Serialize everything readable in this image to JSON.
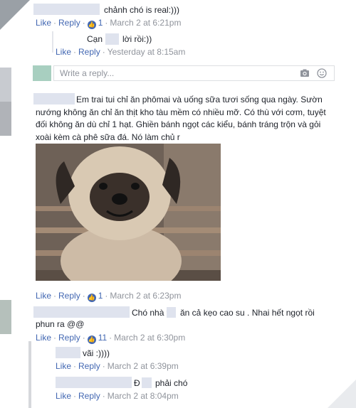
{
  "actions": {
    "like": "Like",
    "reply": "Reply",
    "separator": "·"
  },
  "comments": [
    {
      "text": "chảnh chó is real:)))",
      "likes": "1",
      "time": "March 2 at 6:21pm"
    },
    {
      "text_a": "Cạn",
      "text_b": "lời rồi:))",
      "time": "Yesterday at 8:15am"
    },
    {
      "text": "Em trai tui chỉ ăn phômai và uống sữa tươi sống qua ngày. Sườn nướng không ăn chỉ ăn thịt kho tàu mềm có nhiều mỡ. Có thù với cơm, tuyệt đối không ăn dù chỉ 1 hạt. Ghiền bánh ngọt các kiểu, bánh tráng trộn và gỏi xoài kèm cà phê sữa đá. Nó làm chủ r",
      "likes": "1",
      "time": "March 2 at 6:23pm"
    },
    {
      "text_a": "Chó nhà t",
      "text_b": "ăn cả kẹo cao su . Nhai hết ngọt rồi",
      "text_c": "phun ra @@",
      "likes": "11",
      "time": "March 2 at 6:30pm"
    },
    {
      "text": "vãi :))))",
      "time": "March 2 at 6:39pm"
    },
    {
      "text_a": "Đ",
      "text_b": "phải chó",
      "time": "March 2 at 8:04pm"
    }
  ],
  "reply_box": {
    "placeholder": "Write a reply..."
  },
  "icons": {
    "like": "thumbs-up-icon",
    "camera": "camera-icon",
    "emoji": "smiley-icon"
  },
  "colors": {
    "link": "#4267b2",
    "meta": "#90949c",
    "text": "#1d2129",
    "avatar_teal": "#a8cfc0"
  }
}
